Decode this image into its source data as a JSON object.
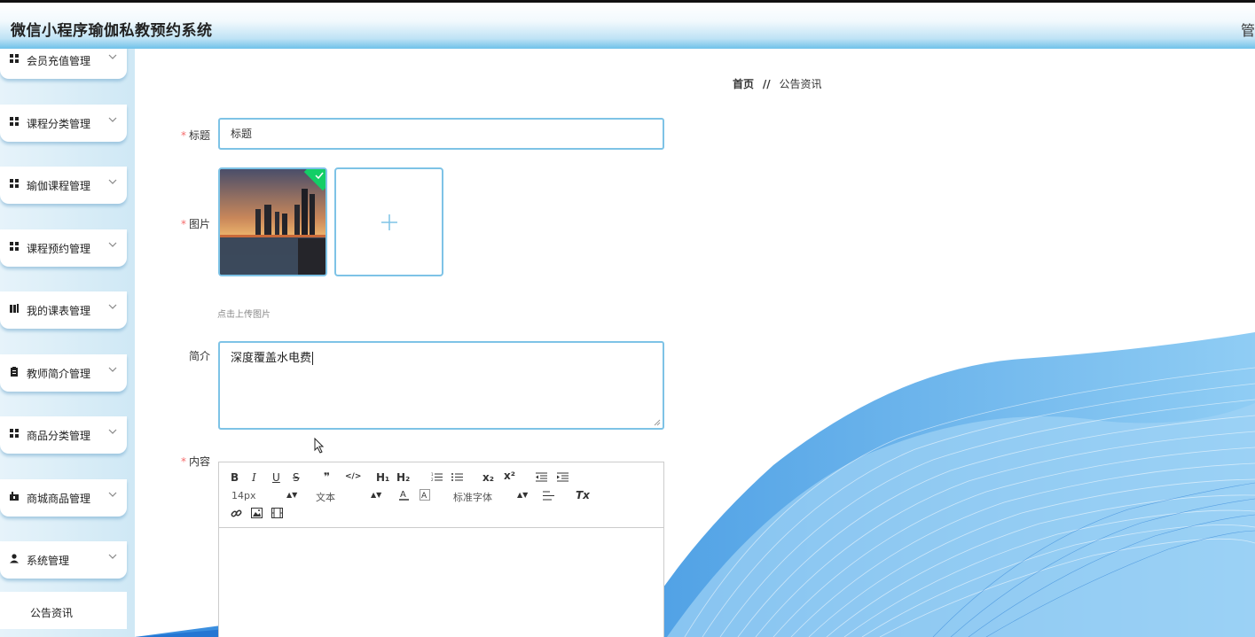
{
  "header": {
    "app_title": "微信小程序瑜伽私教预约系统",
    "admin_label": "管"
  },
  "sidebar": {
    "items": [
      {
        "label": "会员充值管理",
        "icon": "grid-icon"
      },
      {
        "label": "课程分类管理",
        "icon": "grid-icon"
      },
      {
        "label": "瑜伽课程管理",
        "icon": "grid-icon"
      },
      {
        "label": "课程预约管理",
        "icon": "grid-icon"
      },
      {
        "label": "我的课表管理",
        "icon": "book-icon"
      },
      {
        "label": "教师简介管理",
        "icon": "clipboard-icon"
      },
      {
        "label": "商品分类管理",
        "icon": "grid-icon"
      },
      {
        "label": "商城商品管理",
        "icon": "shop-icon"
      },
      {
        "label": "系统管理",
        "icon": "user-icon"
      }
    ],
    "sub_items": [
      {
        "label": "公告资讯"
      }
    ]
  },
  "breadcrumb": {
    "home": "首页",
    "separator": "//",
    "current": "公告资讯"
  },
  "form": {
    "title": {
      "label": "标题",
      "value": "标题"
    },
    "image": {
      "label": "图片",
      "upload_tip": "点击上传图片"
    },
    "intro": {
      "label": "简介",
      "value": "深度覆盖水电费"
    },
    "content": {
      "label": "内容"
    }
  },
  "editor": {
    "toolbar": {
      "bold": "B",
      "italic": "I",
      "underline": "U",
      "strike": "S",
      "blockquote": "❞",
      "code": "</>",
      "h1": "H₁",
      "h2": "H₂",
      "subscript": "x₂",
      "superscript": "x²",
      "size_select": "14px",
      "header_select": "文本",
      "font_select": "标准字体",
      "clean": "Tx"
    }
  },
  "colors": {
    "accent": "#7ec3e6",
    "required": "#f56c6c",
    "header_gradient_end": "#6fc1ea",
    "success": "#13ce66"
  }
}
